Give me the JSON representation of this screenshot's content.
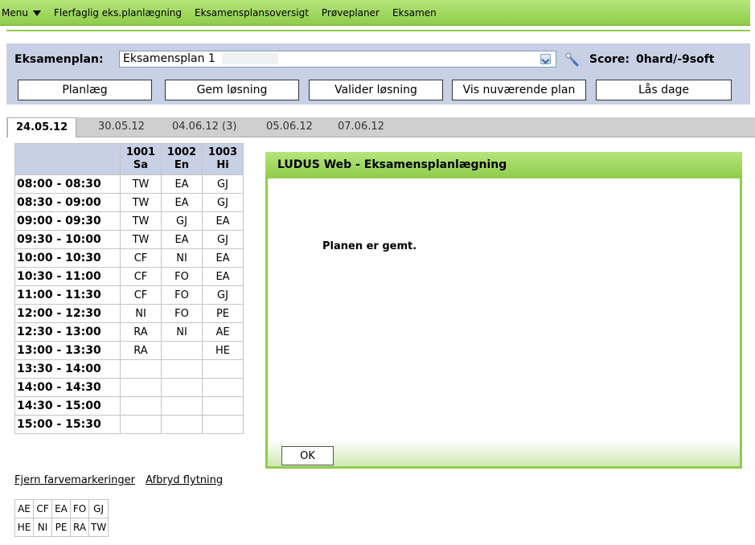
{
  "menu": {
    "label": "Menu",
    "items": [
      "Flerfaglig eks.planlægning",
      "Eksamensplansoversigt",
      "Prøveplaner",
      "Eksamen"
    ]
  },
  "header": {
    "plan_label": "Eksamenplan:",
    "plan_value": "Eksamensplan 1",
    "score_label": "Score:",
    "score_value": "0hard/-9soft"
  },
  "buttons": {
    "plan": "Planlæg",
    "save": "Gem løsning",
    "validate": "Valider løsning",
    "show": "Vis nuværende plan",
    "lock": "Lås dage"
  },
  "tabs": [
    "24.05.12",
    "30.05.12",
    "04.06.12 (3)",
    "05.06.12",
    "07.06.12"
  ],
  "schedule": {
    "rooms": [
      {
        "num": "1001",
        "abbr": "Sa"
      },
      {
        "num": "1002",
        "abbr": "En"
      },
      {
        "num": "1003",
        "abbr": "Hi"
      }
    ],
    "rows": [
      {
        "time": "08:00 - 08:30",
        "c": [
          "TW",
          "EA",
          "GJ"
        ]
      },
      {
        "time": "08:30 - 09:00",
        "c": [
          "TW",
          "EA",
          "GJ"
        ]
      },
      {
        "time": "09:00 - 09:30",
        "c": [
          "TW",
          "GJ",
          "EA"
        ]
      },
      {
        "time": "09:30 - 10:00",
        "c": [
          "TW",
          "EA",
          "GJ"
        ]
      },
      {
        "time": "10:00 - 10:30",
        "c": [
          "CF",
          "NI",
          "EA"
        ]
      },
      {
        "time": "10:30 - 11:00",
        "c": [
          "CF",
          "FO",
          "EA"
        ]
      },
      {
        "time": "11:00 - 11:30",
        "c": [
          "CF",
          "FO",
          "GJ"
        ]
      },
      {
        "time": "12:00 - 12:30",
        "c": [
          "NI",
          "FO",
          "PE"
        ]
      },
      {
        "time": "12:30 - 13:00",
        "c": [
          "RA",
          "NI",
          "AE"
        ]
      },
      {
        "time": "13:00 - 13:30",
        "c": [
          "RA",
          "",
          "HE"
        ]
      },
      {
        "time": "13:30 - 14:00",
        "c": [
          "",
          "",
          ""
        ]
      },
      {
        "time": "14:00 - 14:30",
        "c": [
          "",
          "",
          ""
        ]
      },
      {
        "time": "14:30 - 15:00",
        "c": [
          "",
          "",
          ""
        ]
      },
      {
        "time": "15:00 - 15:30",
        "c": [
          "",
          "",
          ""
        ]
      }
    ]
  },
  "links": {
    "remove_colors": "Fjern farvemarkeringer",
    "cancel_move": "Afbryd flytning"
  },
  "legend": [
    [
      "AE",
      "CF",
      "EA",
      "FO",
      "GJ"
    ],
    [
      "HE",
      "NI",
      "PE",
      "RA",
      "TW"
    ]
  ],
  "dialog": {
    "title": "LUDUS Web - Eksamensplanlægning",
    "message": "Planen er gemt.",
    "ok": "OK"
  }
}
